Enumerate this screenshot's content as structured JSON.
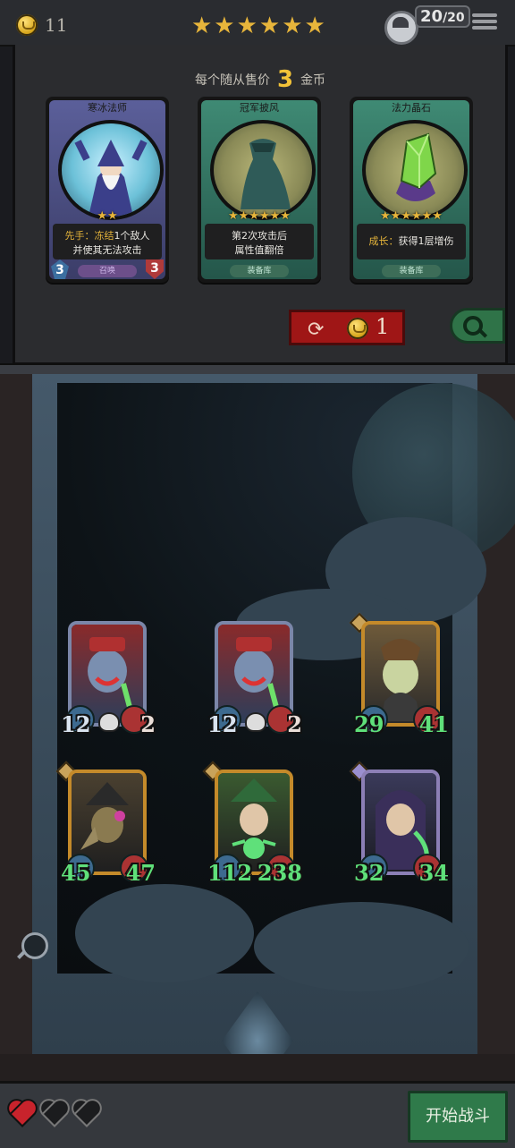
{
  "topbar": {
    "gold": "11",
    "stars": "★★★★★★",
    "population": "20",
    "population_max": "/20"
  },
  "shop": {
    "price_prefix": "每个随从售价",
    "price_value": "3",
    "price_suffix": "金币",
    "cards": [
      {
        "title": "寒冰法师",
        "stars": "★★",
        "desc_keyword": "先手：冻结",
        "desc_rest": "1个敌人",
        "desc_line2": "并使其无法攻击",
        "tag": "召唤",
        "attack": "3",
        "health": "3"
      },
      {
        "title": "冠军披风",
        "stars": "★★★★★★",
        "desc_line1": "第2次攻击后",
        "desc_line2": "属性值翻倍",
        "tag": "装备库"
      },
      {
        "title": "法力晶石",
        "stars": "★★★★★★",
        "desc_keyword": "成长：",
        "desc_rest": "获得1层增伤",
        "tag": "装备库"
      }
    ],
    "reroll_cost": "1"
  },
  "board": {
    "units": [
      {
        "attack": "12",
        "health": "2"
      },
      {
        "attack": "12",
        "health": "2"
      },
      {
        "attack": "29",
        "health": "41"
      },
      {
        "attack": "45",
        "health": "47"
      },
      {
        "attack": "112",
        "health": "238"
      },
      {
        "attack": "32",
        "health": "34"
      }
    ]
  },
  "bottombar": {
    "lives_full": 1,
    "lives_total": 3,
    "fight_label": "开始战斗"
  },
  "colors": {
    "accent_gold": "#e7b53b",
    "reroll_red": "#9f1616",
    "fight_green": "#2f7a4a",
    "buff_green": "#5fe07a"
  }
}
